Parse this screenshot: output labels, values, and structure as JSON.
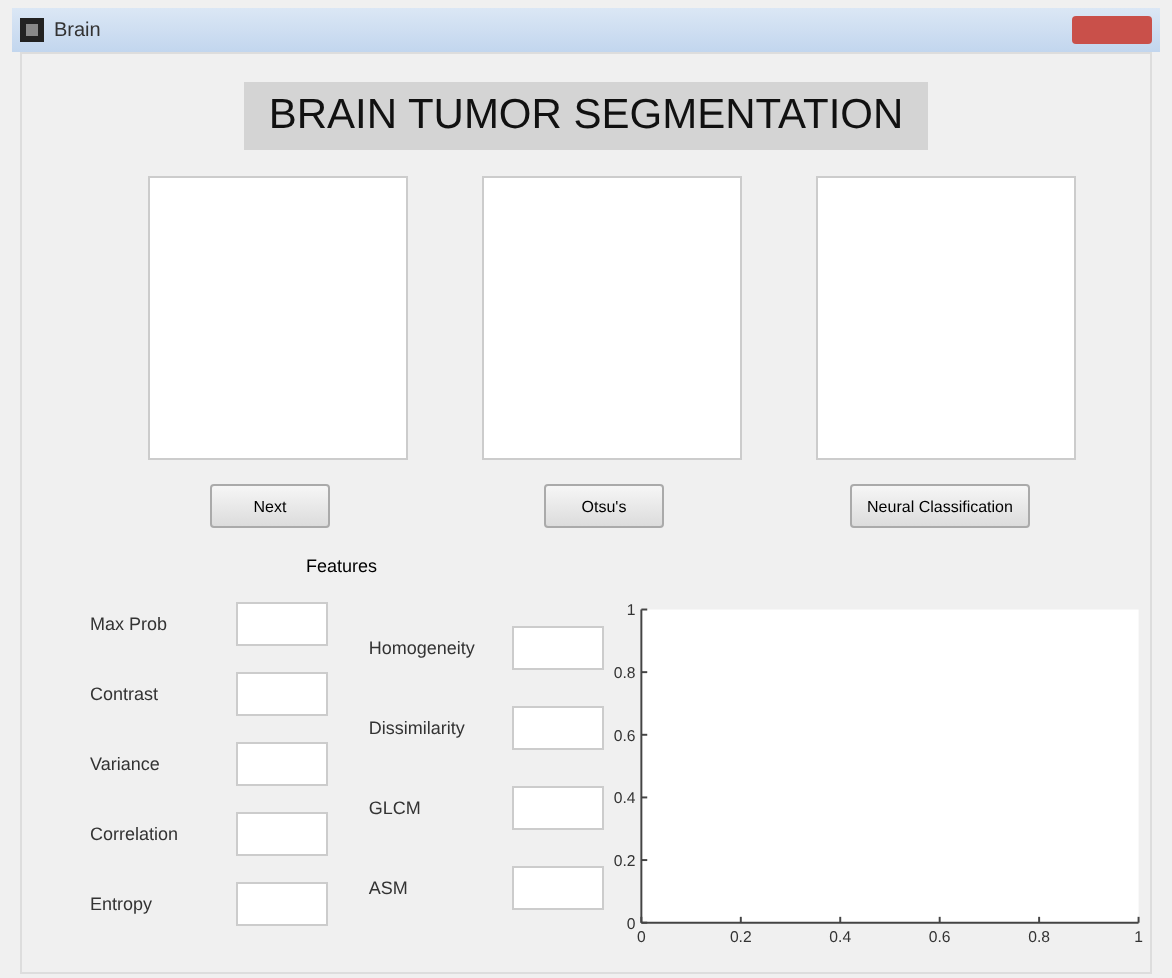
{
  "window": {
    "title": "Brain"
  },
  "heading": "BRAIN TUMOR SEGMENTATION",
  "buttons": [
    {
      "label": "Next"
    },
    {
      "label": "Otsu's"
    },
    {
      "label": "Neural Classification"
    }
  ],
  "features_label": "Features",
  "features_left": [
    {
      "label": "Max Prob"
    },
    {
      "label": "Contrast"
    },
    {
      "label": "Variance"
    },
    {
      "label": "Correlation"
    },
    {
      "label": "Entropy"
    }
  ],
  "features_right": [
    {
      "label": "Homogeneity"
    },
    {
      "label": "Dissimilarity"
    },
    {
      "label": "GLCM"
    },
    {
      "label": "ASM"
    }
  ],
  "plot": {
    "chart_data": {
      "type": "line",
      "xlim": [
        0,
        1
      ],
      "ylim": [
        0,
        1
      ],
      "xticks": [
        {
          "value": 0,
          "label": "0"
        },
        {
          "value": 0.2,
          "label": "0.2"
        },
        {
          "value": 0.4,
          "label": "0.4"
        },
        {
          "value": 0.6,
          "label": "0.6"
        },
        {
          "value": 0.8,
          "label": "0.8"
        },
        {
          "value": 1,
          "label": "1"
        }
      ],
      "yticks": [
        {
          "value": 0,
          "label": "0"
        },
        {
          "value": 0.2,
          "label": "0.2"
        },
        {
          "value": 0.4,
          "label": "0.4"
        },
        {
          "value": 0.6,
          "label": "0.6"
        },
        {
          "value": 0.8,
          "label": "0.8"
        },
        {
          "value": 1,
          "label": "1"
        }
      ]
    }
  }
}
